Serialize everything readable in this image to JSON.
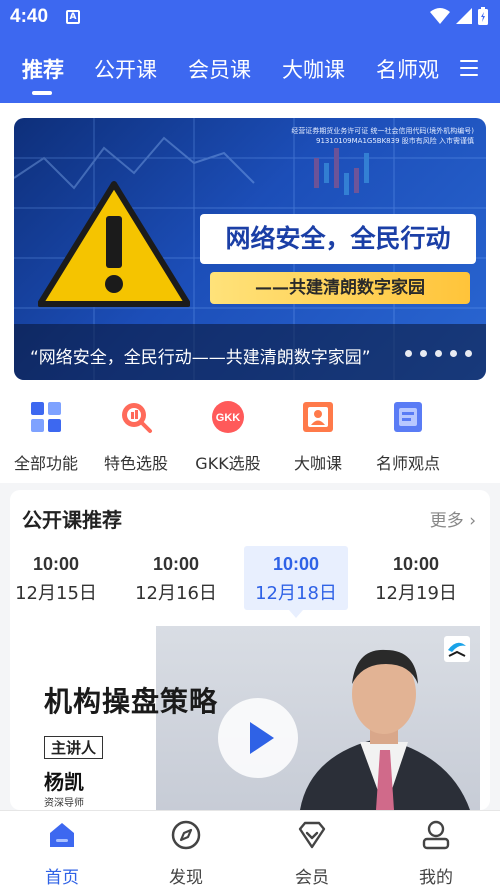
{
  "status_bar": {
    "time": "4:40",
    "badge": "A"
  },
  "tabs": [
    {
      "label": "推荐"
    },
    {
      "label": "公开课"
    },
    {
      "label": "会员课"
    },
    {
      "label": "大咖课"
    },
    {
      "label": "名师观"
    }
  ],
  "banner": {
    "license_text": "经营证券期货业务许可证 统一社会信用代码(境外机构编号) 91310109MA1G5BK839 股市有风险 入市需谨慎",
    "headline": "网络安全，全民行动",
    "subline": "——共建清朗数字家园",
    "caption": "“网络安全，全民行动——共建清朗数字家园”"
  },
  "functions": [
    {
      "label": "全部功能",
      "icon": "grid-icon"
    },
    {
      "label": "特色选股",
      "icon": "stock-pick-icon"
    },
    {
      "label": "GKK选股",
      "icon": "gkk-icon",
      "icon_text": "GKK"
    },
    {
      "label": "大咖课",
      "icon": "expert-icon"
    },
    {
      "label": "名师观点",
      "icon": "notebook-icon"
    }
  ],
  "open_course": {
    "title": "公开课推荐",
    "more": "更多",
    "dates": [
      {
        "time": "10:00",
        "date": "12月15日"
      },
      {
        "time": "10:00",
        "date": "12月16日"
      },
      {
        "time": "10:00",
        "date": "12月18日"
      },
      {
        "time": "10:00",
        "date": "12月19日"
      }
    ],
    "course": {
      "title": "机构操盘策略",
      "host_tag": "主讲人",
      "host_name": "杨凯",
      "host_role": "资深导师"
    }
  },
  "bottom_nav": [
    {
      "label": "首页",
      "icon": "home-icon"
    },
    {
      "label": "发现",
      "icon": "compass-icon"
    },
    {
      "label": "会员",
      "icon": "vip-icon"
    },
    {
      "label": "我的",
      "icon": "profile-icon"
    }
  ],
  "colors": {
    "brand": "#3d68f0",
    "accent": "#2f62e6",
    "warning": "#f5c400"
  }
}
